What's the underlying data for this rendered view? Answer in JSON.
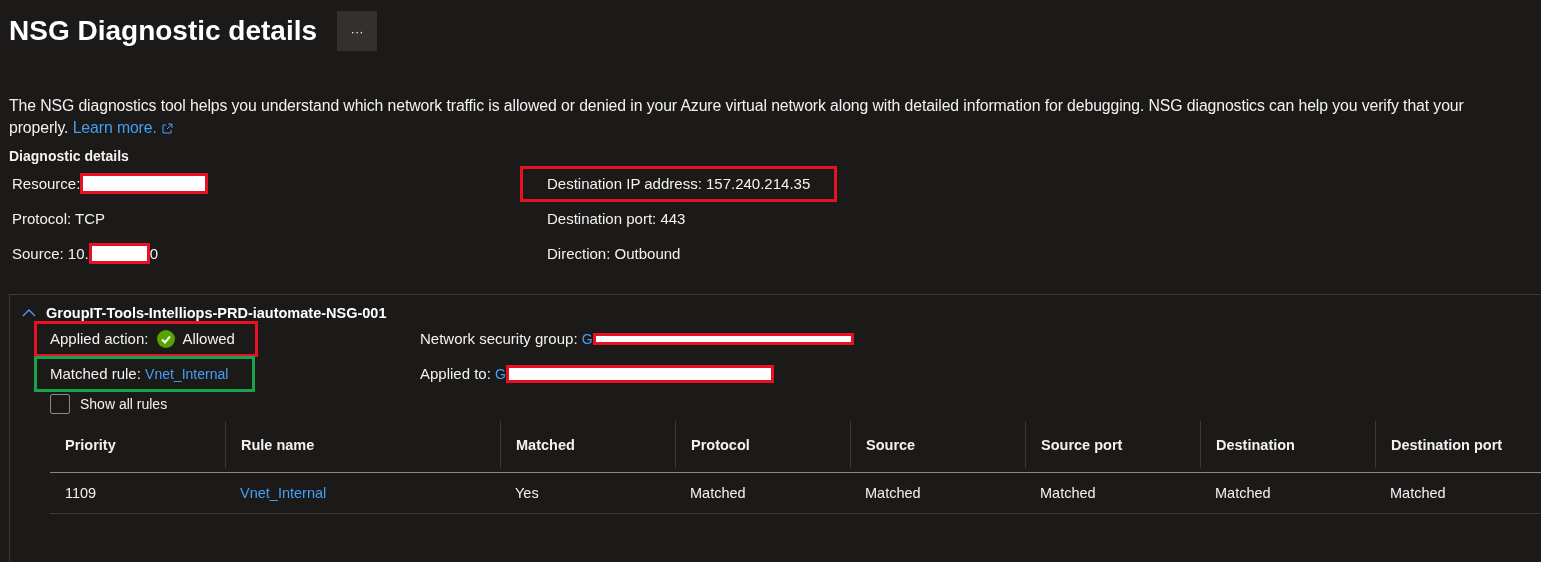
{
  "header": {
    "title": "NSG Diagnostic details",
    "more_button": "···"
  },
  "description": {
    "text": "The NSG diagnostics tool helps you understand which network traffic is allowed or denied in your Azure virtual network along with detailed information for debugging. NSG diagnostics can help you verify that your",
    "text_continued": "properly.",
    "link": "Learn more."
  },
  "details": {
    "heading": "Diagnostic details",
    "left": [
      {
        "label": "Resource:",
        "redacted": true
      },
      {
        "label": "Protocol: TCP",
        "redacted": false
      },
      {
        "label": "Source: 10.",
        "after": "0",
        "redacted": true
      }
    ],
    "right": [
      {
        "label": "Destination IP address: 157.240.214.35",
        "redacted": false,
        "color": "#e81123"
      },
      {
        "label": "Destination port: 443",
        "redacted": false
      },
      {
        "label": "Direction: Outbound",
        "redacted": false
      }
    ]
  },
  "group": {
    "name": "GroupIT-Tools-Intelliops-PRD-iautomate-NSG-001",
    "expanded": true,
    "applied_action": {
      "label": "Applied action:",
      "value": "Allowed",
      "allowed": true,
      "color": "#e81123"
    },
    "matched_rule": {
      "label": "Matched rule:",
      "value": "Vnet_Internal",
      "color": "#16a34a"
    },
    "network_security_group": {
      "label": "Network security group:",
      "value": "G",
      "redacted": true
    },
    "applied_to": {
      "label": "Applied to:",
      "value": "G",
      "redacted": true
    },
    "show_all_rules": {
      "label": "Show all rules",
      "checked": false
    },
    "table": {
      "columns": [
        "Priority",
        "Rule name",
        "Matched",
        "Protocol",
        "Source",
        "Source port",
        "Destination",
        "Destination port"
      ],
      "rows": [
        {
          "cells": [
            "1109",
            "Vnet_Internal",
            "Yes",
            "Matched",
            "Matched",
            "Matched",
            "Matched",
            "Matched"
          ]
        }
      ]
    }
  }
}
